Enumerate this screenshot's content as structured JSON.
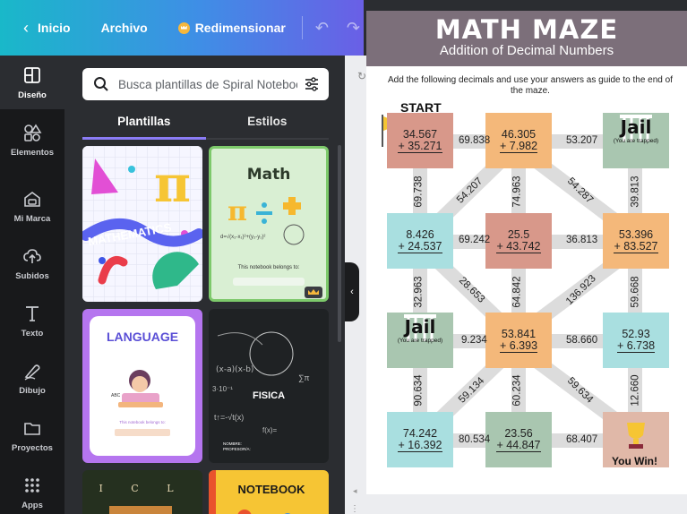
{
  "topbar": {
    "back_label": "Inicio",
    "file_label": "Archivo",
    "resize_label": "Redimensionar"
  },
  "rail": {
    "items": [
      {
        "label": "Diseño",
        "icon": "layout-icon"
      },
      {
        "label": "Elementos",
        "icon": "shapes-icon"
      },
      {
        "label": "Mi Marca",
        "icon": "brand-icon"
      },
      {
        "label": "Subidos",
        "icon": "cloud-upload-icon"
      },
      {
        "label": "Texto",
        "icon": "text-icon"
      },
      {
        "label": "Dibujo",
        "icon": "draw-icon"
      },
      {
        "label": "Proyectos",
        "icon": "folder-icon"
      },
      {
        "label": "Apps",
        "icon": "apps-grid-icon"
      }
    ]
  },
  "panel": {
    "search_placeholder": "Busca plantillas de Spiral Noteboo",
    "tabs": [
      "Plantillas",
      "Estilos"
    ],
    "templates": [
      {
        "title": "MATHEMATICS"
      },
      {
        "title": "Math",
        "caption": "This notebook belongs to:"
      },
      {
        "title": "LANGUAGE",
        "caption": "This notebook belongs to:"
      },
      {
        "title": "FISICA",
        "caption1": "NOMBRE:",
        "caption2": "PROFESOR/A:"
      },
      {
        "title": "I C L"
      },
      {
        "title": "NOTEBOOK"
      }
    ]
  },
  "sheet": {
    "title": "MATH MAZE",
    "subtitle": "Addition of Decimal Numbers",
    "instructions": "Add the following decimals and use your answers as guide to the end of the maze.",
    "start": "START",
    "jail_word": "Jail",
    "jail_sub": "(You are trapped)",
    "you_win": "You Win!",
    "boxes": [
      {
        "a": "34.567",
        "b": "+ 35.271",
        "color": "#d8988a"
      },
      {
        "a": "46.305",
        "b": "+  7.982",
        "color": "#f4b87a"
      },
      {
        "a": "8.426",
        "b": "+ 24.537",
        "color": "#a9dfe0"
      },
      {
        "a": "25.5",
        "b": "+ 43.742",
        "color": "#d8988a"
      },
      {
        "a": "53.396",
        "b": "+ 83.527",
        "color": "#f4b87a"
      },
      {
        "a": "53.841",
        "b": "+  6.393",
        "color": "#f4b87a"
      },
      {
        "a": "52.93",
        "b": "+  6.738",
        "color": "#a9dfe0"
      },
      {
        "a": "74.242",
        "b": "+ 16.392",
        "color": "#a9dfe0"
      },
      {
        "a": "23.56",
        "b": "+ 44.847",
        "color": "#a9c6b0"
      }
    ],
    "edges": {
      "h1": "69.838",
      "h2": "53.207",
      "h3": "69.242",
      "h4": "36.813",
      "h5": "9.234",
      "h6": "58.660",
      "h7": "80.534",
      "h8": "68.407",
      "v1": "69.738",
      "v2": "74.963",
      "v3": "39.813",
      "v4": "32.963",
      "v5": "64.842",
      "v6": "59.668",
      "v7": "90.634",
      "v8": "60.234",
      "v9": "12.660",
      "d1": "54.207",
      "d2": "54.287",
      "d3": "28.653",
      "d4": "136.923",
      "d5": "59.134",
      "d6": "59.634"
    }
  }
}
